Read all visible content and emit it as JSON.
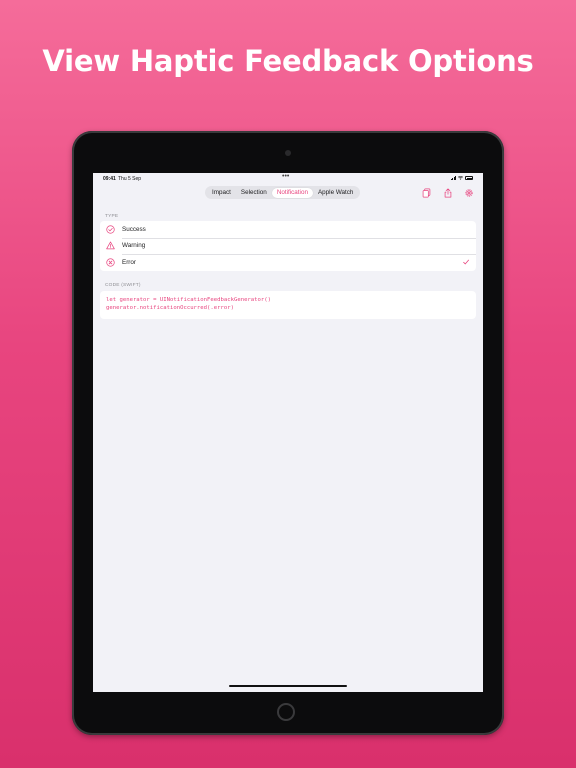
{
  "headline": "View Haptic Feedback Options",
  "status_bar": {
    "time": "09:41",
    "date": "Thu 5 Sep"
  },
  "tabs": [
    {
      "label": "Impact",
      "selected": false
    },
    {
      "label": "Selection",
      "selected": false
    },
    {
      "label": "Notification",
      "selected": true
    },
    {
      "label": "Apple Watch",
      "selected": false
    }
  ],
  "toolbar": {
    "icons": [
      "copy-icon",
      "share-icon",
      "settings-icon"
    ]
  },
  "type_section": {
    "header": "TYPE",
    "items": [
      {
        "label": "Success",
        "icon": "checkmark-circle-icon",
        "selected": false
      },
      {
        "label": "Warning",
        "icon": "warning-triangle-icon",
        "selected": false
      },
      {
        "label": "Error",
        "icon": "x-circle-icon",
        "selected": true
      }
    ]
  },
  "code_section": {
    "header": "CODE (SWIFT)",
    "lines": [
      "let generator = UINotificationFeedbackGenerator()",
      "generator.notificationOccurred(.error)"
    ]
  },
  "colors": {
    "accent": "#e8457f",
    "background_top": "#f56c9a",
    "background_bottom": "#d9306c",
    "screen_bg": "#f2f2f7"
  }
}
